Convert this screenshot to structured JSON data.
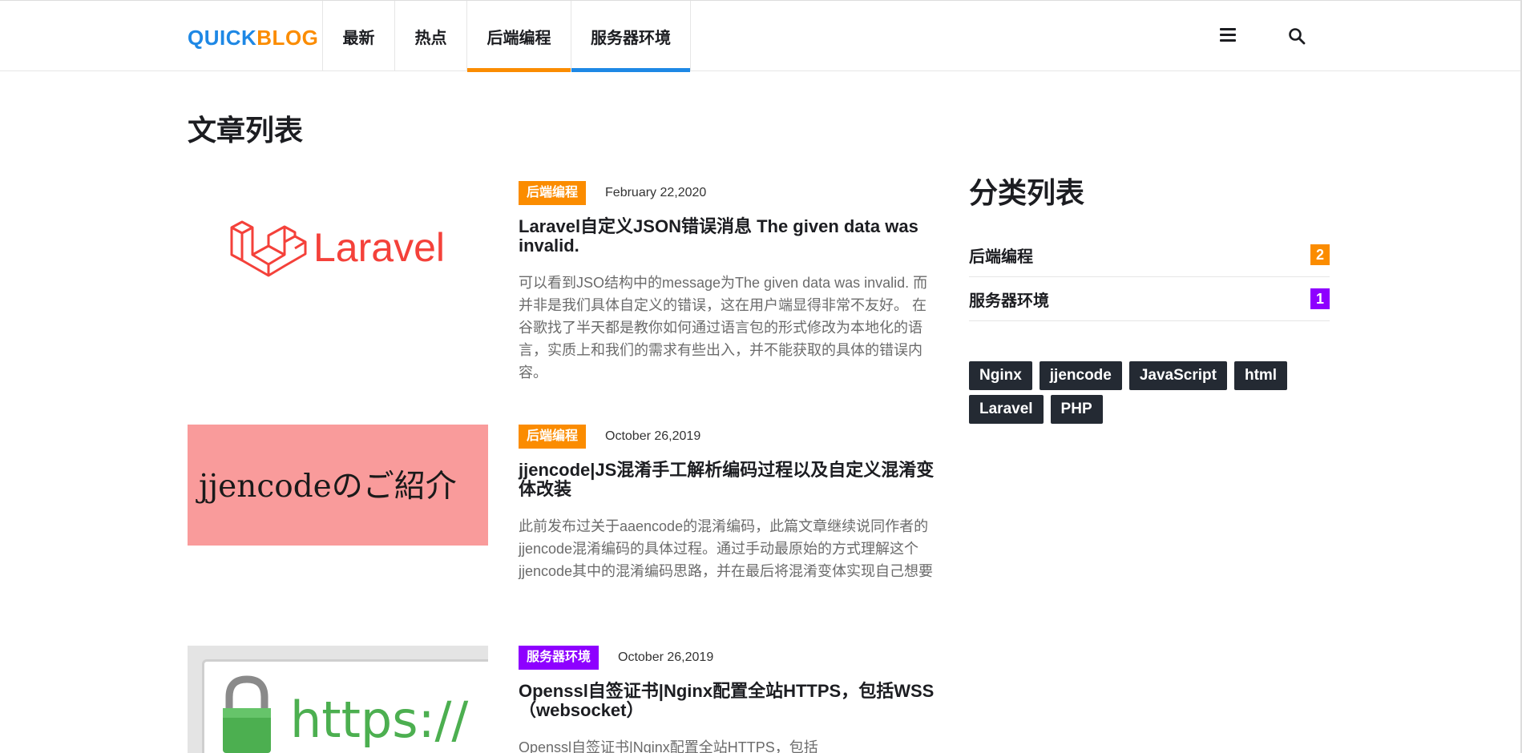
{
  "header": {
    "logo_part1": "QUICK",
    "logo_part2": "BLOG",
    "nav": [
      {
        "label": "最新"
      },
      {
        "label": "热点"
      },
      {
        "label": "后端编程"
      },
      {
        "label": "服务器环境"
      }
    ],
    "menu_icon": "hamburger-menu-icon",
    "search_icon": "search-icon"
  },
  "main": {
    "title": "文章列表",
    "posts": [
      {
        "thumb_text": "Laravel",
        "category": "后端编程",
        "category_color": "#fb8c00",
        "date": "February 22,2020",
        "title": "Laravel自定义JSON错误消息 The given data was invalid.",
        "excerpt": "可以看到JSO结构中的message为The given data was invalid. 而并非是我们具体自定义的错误，这在用户端显得非常不友好。 在谷歌找了半天都是教你如何通过语言包的形式修改为本地化的语言，实质上和我们的需求有些出入，并不能获取的具体的错误内容。"
      },
      {
        "thumb_text": "jjencodeのご紹介",
        "category": "后端编程",
        "category_color": "#fb8c00",
        "date": "October 26,2019",
        "title": "jjencode|JS混淆手工解析编码过程以及自定义混淆变体改装",
        "excerpt": "此前发布过关于aaencode的混淆编码，此篇文章继续说同作者的jjencode混淆编码的具体过程。通过手动最原始的方式理解这个jjencode其中的混淆编码思路，并在最后将混淆变体实现自己想要"
      },
      {
        "thumb_text": "https://",
        "category": "服务器环境",
        "category_color": "#8e00ff",
        "date": "October 26,2019",
        "title": "Openssl自签证书|Nginx配置全站HTTPS，包括WSS（websocket）",
        "excerpt": "Openssl自签证书|Nginx配置全站HTTPS，包括"
      }
    ]
  },
  "sidebar": {
    "title": "分类列表",
    "categories": [
      {
        "name": "后端编程",
        "count": "2",
        "color": "#fb8c00"
      },
      {
        "name": "服务器环境",
        "count": "1",
        "color": "#8e00ff"
      }
    ],
    "tags": [
      "Nginx",
      "jjencode",
      "JavaScript",
      "html",
      "Laravel",
      "PHP"
    ]
  }
}
